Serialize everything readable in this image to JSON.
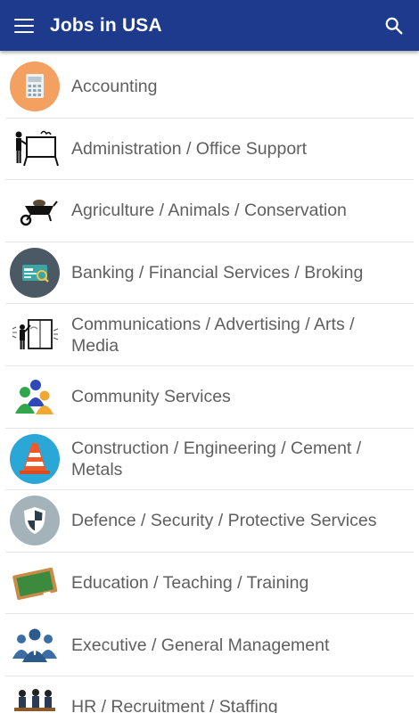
{
  "appbar": {
    "title": "Jobs in USA",
    "menu_icon": "hamburger-menu-icon",
    "search_icon": "search-icon",
    "background_color": "#1e3a8c"
  },
  "categories": [
    {
      "label": "Accounting",
      "icon": "calculator-icon"
    },
    {
      "label": "Administration / Office Support",
      "icon": "presentation-board-icon"
    },
    {
      "label": "Agriculture / Animals / Conservation",
      "icon": "wheelbarrow-icon"
    },
    {
      "label": "Banking / Financial Services / Broking",
      "icon": "credit-card-icon"
    },
    {
      "label": "Communications / Advertising / Arts / Media",
      "icon": "billboard-painter-icon"
    },
    {
      "label": "Community Services",
      "icon": "people-group-icon"
    },
    {
      "label": "Construction / Engineering / Cement / Metals",
      "icon": "traffic-cone-icon"
    },
    {
      "label": "Defence / Security / Protective Services",
      "icon": "shield-icon"
    },
    {
      "label": "Education / Teaching / Training",
      "icon": "chalkboard-icon"
    },
    {
      "label": "Executive / General Management",
      "icon": "executive-team-icon"
    },
    {
      "label": "HR / Recruitment / Staffing",
      "icon": "interview-icon"
    }
  ]
}
